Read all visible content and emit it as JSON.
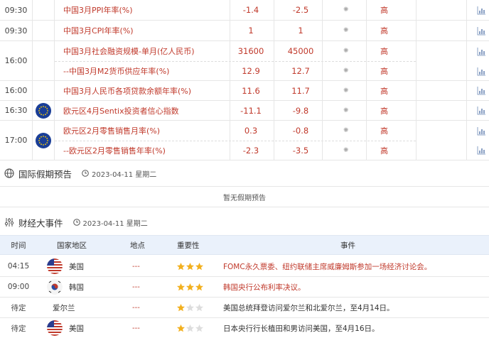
{
  "calendar": {
    "rows": [
      {
        "time": "09:30",
        "events": [
          {
            "title": "中国3月PPI年率(%)",
            "prev": "-1.4",
            "forecast": "-2.5",
            "importance": "高"
          }
        ]
      },
      {
        "time": "09:30",
        "events": [
          {
            "title": "中国3月CPI年率(%)",
            "prev": "1",
            "forecast": "1",
            "importance": "高"
          }
        ]
      },
      {
        "time": "16:00",
        "events": [
          {
            "title": "中国3月社会融资规模-单月(亿人民币)",
            "prev": "31600",
            "forecast": "45000",
            "importance": "高"
          },
          {
            "title": "--中国3月M2货币供应年率(%)",
            "prev": "12.9",
            "forecast": "12.7",
            "importance": "高"
          }
        ]
      },
      {
        "time": "16:00",
        "events": [
          {
            "title": "中国3月人民币各项贷款余额年率(%)",
            "prev": "11.6",
            "forecast": "11.7",
            "importance": "高"
          }
        ]
      },
      {
        "time": "16:30",
        "flag": "eu-flag",
        "events": [
          {
            "title": "欧元区4月Sentix投资者信心指数",
            "prev": "-11.1",
            "forecast": "-9.8",
            "importance": "高"
          }
        ]
      },
      {
        "time": "17:00",
        "flag": "eu-flag",
        "events": [
          {
            "title": "欧元区2月零售销售月率(%)",
            "prev": "0.3",
            "forecast": "-0.8",
            "importance": "高"
          },
          {
            "title": "--欧元区2月零售销售年率(%)",
            "prev": "-2.3",
            "forecast": "-3.5",
            "importance": "高"
          }
        ]
      }
    ]
  },
  "holidays": {
    "title": "国际假期预告",
    "date": "2023-04-11 星期二",
    "empty_text": "暂无假期预告"
  },
  "events": {
    "title": "财经大事件",
    "date": "2023-04-11 星期二",
    "headers": {
      "time": "时间",
      "country": "国家地区",
      "place": "地点",
      "importance": "重要性",
      "event": "事件"
    },
    "rows": [
      {
        "time": "04:15",
        "flag": "us-flag",
        "country": "美国",
        "place": "---",
        "stars": 3,
        "event": "FOMC永久票委、纽约联储主席威廉姆斯参加一场经济讨论会。",
        "highlight": true
      },
      {
        "time": "09:00",
        "flag": "kr-flag",
        "country": "韩国",
        "place": "---",
        "stars": 3,
        "event": "韩国央行公布利率决议。",
        "highlight": true
      },
      {
        "time": "待定",
        "flag": "",
        "country": "爱尔兰",
        "place": "---",
        "stars": 1,
        "event": "美国总统拜登访问爱尔兰和北爱尔兰，至4月14日。",
        "highlight": false
      },
      {
        "time": "待定",
        "flag": "us-flag",
        "country": "美国",
        "place": "---",
        "stars": 1,
        "event": "日本央行行长植田和男访问美国，至4月16日。",
        "highlight": false
      }
    ]
  },
  "colors": {
    "accent_red": "#c0392b",
    "star_gold": "#f2b01e",
    "header_bg": "#eaf1fb"
  }
}
